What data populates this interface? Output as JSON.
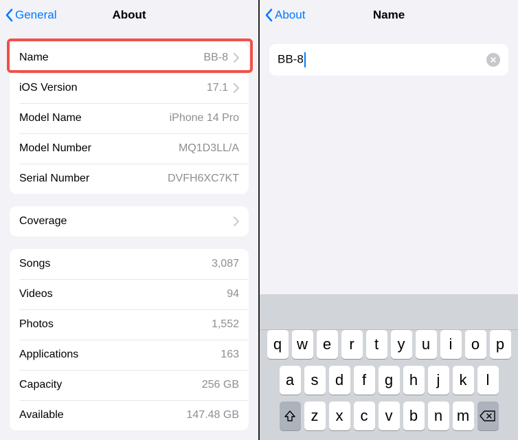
{
  "left": {
    "back_label": "General",
    "title": "About",
    "group1": [
      {
        "label": "Name",
        "value": "BB-8",
        "chevron": true
      },
      {
        "label": "iOS Version",
        "value": "17.1",
        "chevron": true
      },
      {
        "label": "Model Name",
        "value": "iPhone 14 Pro",
        "chevron": false
      },
      {
        "label": "Model Number",
        "value": "MQ1D3LL/A",
        "chevron": false
      },
      {
        "label": "Serial Number",
        "value": "DVFH6XC7KT",
        "chevron": false
      }
    ],
    "group2": [
      {
        "label": "Coverage",
        "value": "",
        "chevron": true
      }
    ],
    "group3": [
      {
        "label": "Songs",
        "value": "3,087",
        "chevron": false
      },
      {
        "label": "Videos",
        "value": "94",
        "chevron": false
      },
      {
        "label": "Photos",
        "value": "1,552",
        "chevron": false
      },
      {
        "label": "Applications",
        "value": "163",
        "chevron": false
      },
      {
        "label": "Capacity",
        "value": "256 GB",
        "chevron": false
      },
      {
        "label": "Available",
        "value": "147.48 GB",
        "chevron": false
      }
    ]
  },
  "right": {
    "back_label": "About",
    "title": "Name",
    "input_value": "BB-8"
  },
  "keyboard": {
    "row1": [
      "q",
      "w",
      "e",
      "r",
      "t",
      "y",
      "u",
      "i",
      "o",
      "p"
    ],
    "row2": [
      "a",
      "s",
      "d",
      "f",
      "g",
      "h",
      "j",
      "k",
      "l"
    ],
    "row3": [
      "z",
      "x",
      "c",
      "v",
      "b",
      "n",
      "m"
    ]
  }
}
